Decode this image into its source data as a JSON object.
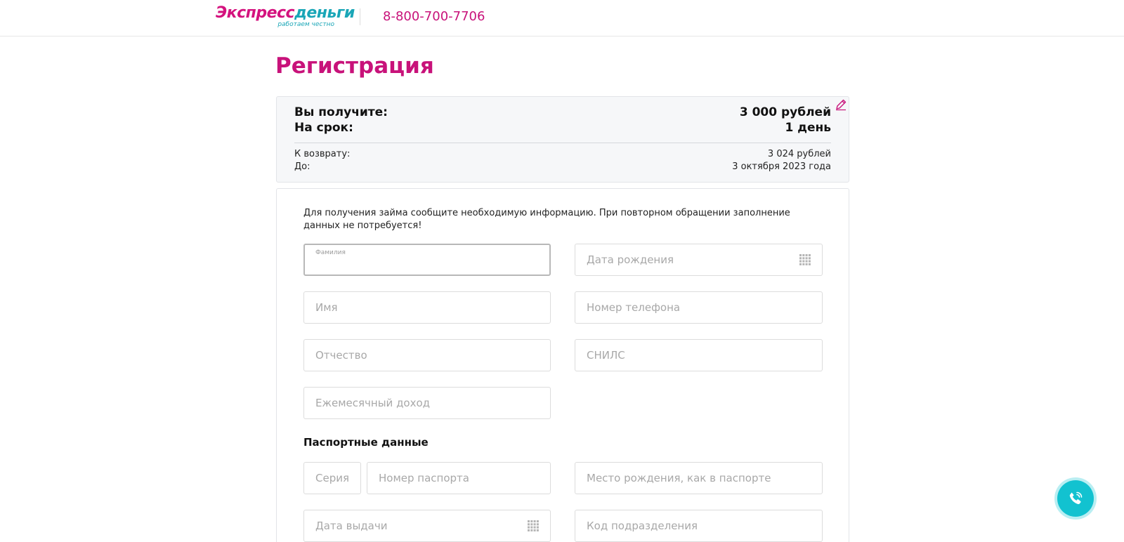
{
  "header": {
    "logo_main_a": "Экспресс",
    "logo_main_b": "деньги",
    "logo_sub": "работаем честно",
    "phone": "8-800-700-7706"
  },
  "page": {
    "title": "Регистрация"
  },
  "summary": {
    "receive_label": "Вы получите:",
    "receive_value": "3 000 рублей",
    "term_label": "На срок:",
    "term_value": "1 день",
    "return_label": "К возврату:",
    "return_value": "3 024 рублей",
    "until_label": "До:",
    "until_value": "3 октября 2023 года"
  },
  "form": {
    "intro": "Для получения займа сообщите необходимую информацию. При повторном обращении заполнение данных не потребуется!",
    "surname": {
      "label": "Фамилия",
      "value": ""
    },
    "birth_date": {
      "placeholder": "Дата рождения"
    },
    "name": {
      "placeholder": "Имя"
    },
    "phone": {
      "placeholder": "Номер телефона"
    },
    "patronymic": {
      "placeholder": "Отчество"
    },
    "snils": {
      "placeholder": "СНИЛС"
    },
    "income": {
      "placeholder": "Ежемесячный доход"
    },
    "passport_section_title": "Паспортные данные",
    "passport_series": {
      "placeholder": "Серия"
    },
    "passport_number": {
      "placeholder": "Номер паспорта"
    },
    "birth_place": {
      "placeholder": "Место рождения, как в паспорте"
    },
    "issue_date": {
      "placeholder": "Дата выдачи"
    },
    "division_code": {
      "placeholder": "Код подразделения"
    }
  },
  "colors": {
    "brand_magenta": "#c8127a",
    "brand_teal": "#12c2d0"
  }
}
